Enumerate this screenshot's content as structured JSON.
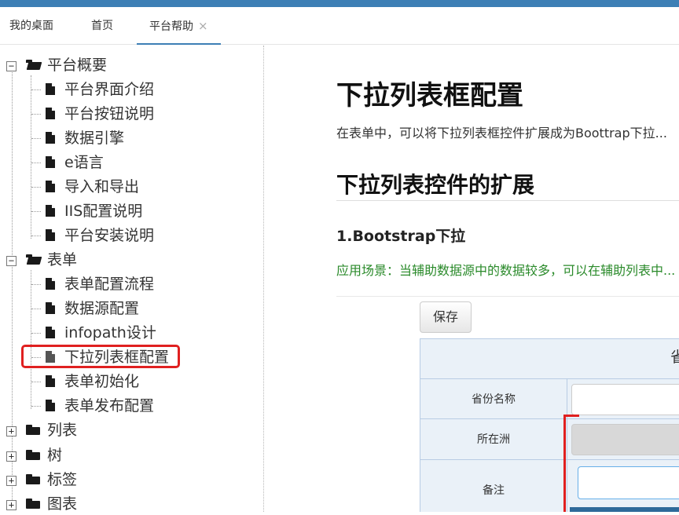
{
  "tabs": {
    "desktop": "我的桌面",
    "home": "首页",
    "help": "平台帮助",
    "close": "×"
  },
  "tree": {
    "overview": "平台概要",
    "overview_items": [
      "平台界面介绍",
      "平台按钮说明",
      "数据引擎",
      "e语言",
      "导入和导出",
      "IIS配置说明",
      "平台安装说明"
    ],
    "form": "表单",
    "form_items": [
      "表单配置流程",
      "数据源配置",
      "infopath设计",
      "下拉列表框配置",
      "表单初始化",
      "表单发布配置"
    ],
    "list": "列表",
    "tree": "树",
    "tag": "标签",
    "chart": "图表",
    "expand": "+",
    "collapse": "−"
  },
  "content": {
    "title": "下拉列表框配置",
    "intro": "在表单中，可以将下拉列表框控件扩展成为Boottrap下拉...",
    "section": "下拉列表控件的扩展",
    "subsection": "1.Bootstrap下拉",
    "scene": "应用场景：当辅助数据源中的数据较多，可以在辅助列表中..."
  },
  "screenshot": {
    "save": "保存",
    "header_char": "省",
    "rows": [
      "省份名称",
      "所在洲",
      "备注"
    ]
  },
  "colors": {
    "accent": "#3d7fb5",
    "highlight": "#e02020",
    "scene_text": "#2a8a2a"
  }
}
